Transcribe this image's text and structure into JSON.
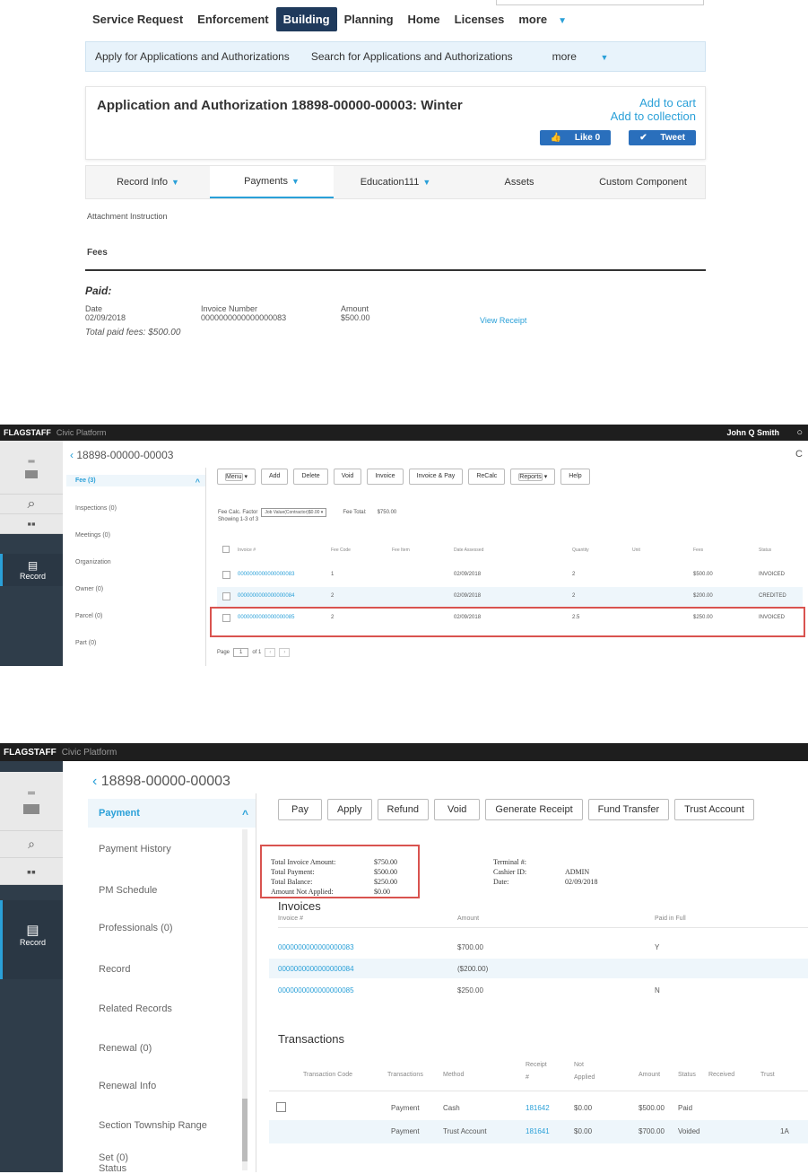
{
  "p1": {
    "nav": [
      "Service Request",
      "Enforcement",
      "Building",
      "Planning",
      "Home",
      "Licenses",
      "more"
    ],
    "subnav": [
      "Apply for Applications and Authorizations",
      "Search for Applications and Authorizations",
      "more"
    ],
    "title": "Application and Authorization 18898-00000-00003: Winter",
    "add_cart": "Add to cart",
    "add_collection": "Add to collection",
    "like": "Like 0",
    "tweet": "Tweet",
    "tabs": [
      "Record Info",
      "Payments",
      "Education111",
      "Assets",
      "Custom Component"
    ],
    "attach": "Attachment Instruction",
    "fees": "Fees",
    "paid": "Paid:",
    "cols": [
      "Date",
      "Invoice Number",
      "Amount"
    ],
    "row": {
      "date": "02/09/2018",
      "invoice": "0000000000000000083",
      "amount": "$500.00",
      "view": "View Receipt"
    },
    "total": "Total paid fees: $500.00"
  },
  "p2": {
    "brand": "FLAGSTAFF",
    "platform": "Civic Platform",
    "user": "John Q Smith",
    "record_id": "18898-00000-00003",
    "nav": [
      "Fee (3)",
      "Inspections (0)",
      "Meetings (0)",
      "Organization",
      "Owner (0)",
      "Parcel (0)",
      "Part (0)"
    ],
    "record_label": "Record",
    "buttons": [
      "Menu",
      "Add",
      "Delete",
      "Void",
      "Invoice",
      "Invoice & Pay",
      "ReCalc",
      "Reports",
      "Help"
    ],
    "fee_calc": "Fee Calc. Factor",
    "fee_calc_value": "Job Value(Contractor)$0.00",
    "fee_total_label": "Fee Total:",
    "fee_total": "$750.00",
    "showing": "Showing 1-3 of 3",
    "cols": [
      "Invoice #",
      "Fee Code",
      "Fee Item",
      "Date Assessed",
      "Quantity",
      "Unit",
      "Fees",
      "Status"
    ],
    "rows": [
      {
        "inv": "0000000000000000083",
        "code": "1",
        "date": "02/09/2018",
        "qty": "2",
        "fees": "$500.00",
        "status": "INVOICED"
      },
      {
        "inv": "0000000000000000084",
        "code": "2",
        "date": "02/09/2018",
        "qty": "2",
        "fees": "$200.00",
        "status": "CREDITED"
      },
      {
        "inv": "0000000000000000085",
        "code": "2",
        "date": "02/09/2018",
        "qty": "2.5",
        "fees": "$250.00",
        "status": "INVOICED"
      }
    ],
    "page_label": "Page",
    "page_value": "1",
    "of": "of 1"
  },
  "p3": {
    "brand": "FLAGSTAFF",
    "platform": "Civic Platform",
    "record_id": "18898-00000-00003",
    "nav": [
      "Payment",
      "Payment History",
      "PM Schedule",
      "Professionals (0)",
      "Record",
      "Related Records",
      "Renewal (0)",
      "Renewal Info",
      "Section Township Range",
      "Set (0)",
      "Status"
    ],
    "record_label": "Record",
    "buttons": [
      "Pay",
      "Apply",
      "Refund",
      "Void",
      "Generate Receipt",
      "Fund Transfer",
      "Trust Account"
    ],
    "summary": [
      {
        "k": "Total Invoice Amount:",
        "v": "$750.00"
      },
      {
        "k": "Total Payment:",
        "v": "$500.00"
      },
      {
        "k": "Total Balance:",
        "v": "$250.00"
      },
      {
        "k": "Amount Not Applied:",
        "v": "$0.00"
      }
    ],
    "right_summary": [
      {
        "k": "Terminal #:",
        "v": ""
      },
      {
        "k": "Cashier ID:",
        "v": "ADMIN"
      },
      {
        "k": "Date:",
        "v": "02/09/2018"
      }
    ],
    "invoices_title": "Invoices",
    "inv_cols": [
      "Invoice #",
      "Amount",
      "Paid in Full"
    ],
    "inv_rows": [
      {
        "inv": "0000000000000000083",
        "amt": "$700.00",
        "paid": "Y"
      },
      {
        "inv": "0000000000000000084",
        "amt": "($200.00)",
        "paid": ""
      },
      {
        "inv": "0000000000000000085",
        "amt": "$250.00",
        "paid": "N"
      }
    ],
    "trans_title": "Transactions",
    "trans_cols": [
      "Transaction Code",
      "Transactions",
      "Method",
      "Receipt #",
      "Not Applied",
      "Amount",
      "Status",
      "Received",
      "Trust"
    ],
    "trans_rows": [
      {
        "t": "Payment",
        "m": "Cash",
        "r": "181642",
        "na": "$0.00",
        "a": "$500.00",
        "s": "Paid",
        "tr": ""
      },
      {
        "t": "Payment",
        "m": "Trust Account",
        "r": "181641",
        "na": "$0.00",
        "a": "$700.00",
        "s": "Voided",
        "tr": "1A"
      }
    ]
  }
}
